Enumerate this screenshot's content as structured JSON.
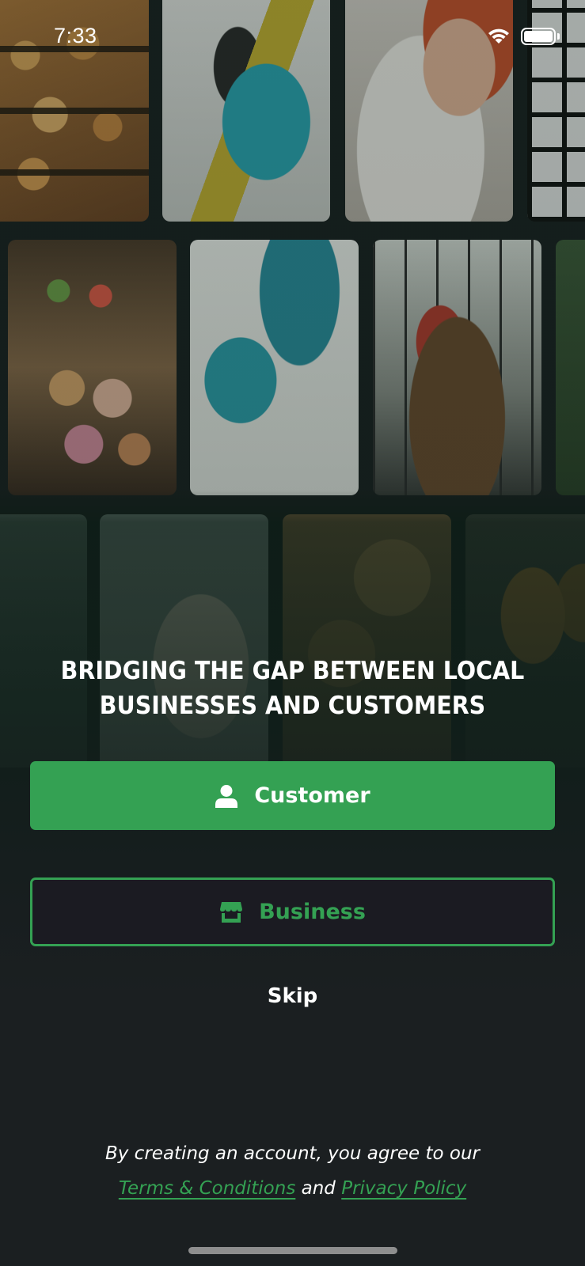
{
  "status_bar": {
    "time": "7:33"
  },
  "headline": "BRIDGING THE GAP BETWEEN LOCAL BUSINESSES AND CUSTOMERS",
  "buttons": {
    "customer": {
      "label": "Customer",
      "icon": "user-icon"
    },
    "business": {
      "label": "Business",
      "icon": "store-icon"
    }
  },
  "skip_label": "Skip",
  "legal": {
    "prefix": "By creating an account, you agree to our",
    "terms": "Terms & Conditions",
    "conjunction": "and",
    "privacy": "Privacy Policy"
  },
  "colors": {
    "accent": "#34a153",
    "background": "#1b1f21",
    "business_button_bg": "#1b1b22"
  }
}
